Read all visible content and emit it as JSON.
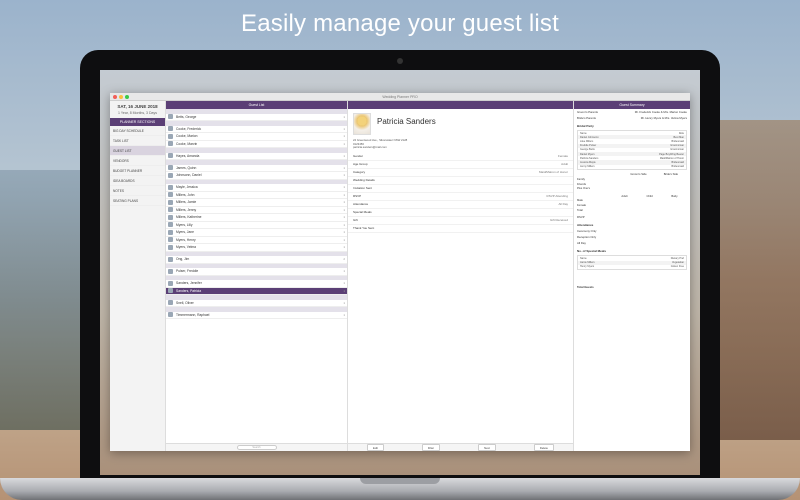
{
  "headline": "Easily manage your guest list",
  "app": {
    "window_title": "Wedding Planner PRO",
    "sidebar": {
      "date": "SAT, 16 JUNE 2018",
      "countdown": "1 Year, 8 Months, 3 Days",
      "section_header": "PLANNER SECTIONS",
      "items": [
        {
          "label": "BIG DAY SCHEDULE"
        },
        {
          "label": "TASK LIST"
        },
        {
          "label": "GUEST LIST"
        },
        {
          "label": "VENDORS"
        },
        {
          "label": "BUDGET PLANNER"
        },
        {
          "label": "IDEA BOARDS"
        },
        {
          "label": "NOTES"
        },
        {
          "label": "SEATING PLANS"
        }
      ]
    },
    "guest_list": {
      "header": "Guest List",
      "rows": [
        {
          "type": "divider"
        },
        {
          "type": "guest",
          "name": "Betts, George",
          "count": "1"
        },
        {
          "type": "divider"
        },
        {
          "type": "guest",
          "name": "Cooke, Frederick",
          "count": "1"
        },
        {
          "type": "guest",
          "name": "Cooke, Marion",
          "count": "1"
        },
        {
          "type": "guest",
          "name": "Cooke, Marvin",
          "count": "1"
        },
        {
          "type": "divider"
        },
        {
          "type": "guest",
          "name": "Hayes, Amanda",
          "count": "1"
        },
        {
          "type": "divider"
        },
        {
          "type": "guest",
          "name": "James, Quinn",
          "count": "1"
        },
        {
          "type": "guest",
          "name": "Johnsonn, Daniel",
          "count": "1"
        },
        {
          "type": "divider"
        },
        {
          "type": "guest",
          "name": "Mayle, Jessica",
          "count": "1"
        },
        {
          "type": "guest",
          "name": "Millers, John",
          "count": "1"
        },
        {
          "type": "guest",
          "name": "Millers, Jamie",
          "count": "1"
        },
        {
          "type": "guest",
          "name": "Millers, Jenny",
          "count": "1"
        },
        {
          "type": "guest",
          "name": "Millers, Katherine",
          "count": "1"
        },
        {
          "type": "guest",
          "name": "Myers, Lilly",
          "count": "1"
        },
        {
          "type": "guest",
          "name": "Myers, Jane",
          "count": "1"
        },
        {
          "type": "guest",
          "name": "Myers, Henry",
          "count": "1"
        },
        {
          "type": "guest",
          "name": "Myers, Velma",
          "count": "1"
        },
        {
          "type": "divider"
        },
        {
          "type": "guest",
          "name": "Ong, Jim",
          "count": "2"
        },
        {
          "type": "divider"
        },
        {
          "type": "guest",
          "name": "Pulser, Freddie",
          "count": "1"
        },
        {
          "type": "divider"
        },
        {
          "type": "guest",
          "name": "Sanders, Jennifer",
          "count": "1"
        },
        {
          "type": "selected",
          "name": "Sanders, Patricia",
          "count": "1"
        },
        {
          "type": "divider"
        },
        {
          "type": "guest",
          "name": "Snell, Oliver",
          "count": "1"
        },
        {
          "type": "divider"
        },
        {
          "type": "guest",
          "name": "Timmermann, Raphael",
          "count": "1"
        }
      ],
      "search_placeholder": "Search"
    },
    "detail": {
      "name": "Patricia Sanders",
      "address_lines": [
        "24 Greenwood Ave., Silverwater NSW 2128",
        "0123456",
        "patricia.sanders@mail.com"
      ],
      "fields": [
        {
          "k": "Gender",
          "v": "Female"
        },
        {
          "k": "Age Group",
          "v": "Adult"
        },
        {
          "k": "Category",
          "v": "Maid/Matron of Honor"
        },
        {
          "k": "Wedding Details",
          "v": ""
        },
        {
          "k": "Invitation Sent",
          "v": ""
        },
        {
          "k": "RSVP",
          "v": "RSVP Attending"
        },
        {
          "k": "Attendance",
          "v": "All Day"
        },
        {
          "k": "Special Meals",
          "v": ""
        },
        {
          "k": "Gift",
          "v": "Gift Received"
        },
        {
          "k": "Thank You Sent",
          "v": ""
        }
      ],
      "buttons": [
        "Edit",
        "Filter",
        "Next",
        "Delete"
      ]
    },
    "summary": {
      "header": "Guest Summary",
      "parents": [
        {
          "k": "Groom's Parents",
          "v": "Mr. Frederick Cooke & Mrs. Marion Cooke"
        },
        {
          "k": "Bride's Parents",
          "v": "Mr. Henry Myers & Mrs. Velma Myers"
        }
      ],
      "bridal_party_title": "Bridal Party",
      "bridal_party": [
        {
          "name": "Name",
          "role": "Role"
        },
        {
          "name": "Daniel Johnsonn",
          "role": "Best Man"
        },
        {
          "name": "Lilee Millers",
          "role": "Bridesmaid"
        },
        {
          "name": "Freddie Pulser",
          "role": "Groomsman"
        },
        {
          "name": "George Betts",
          "role": "Groomsman"
        },
        {
          "name": "Daniel Myers",
          "role": "Page Boy/Ring Bearer"
        },
        {
          "name": "Patricia Sanders",
          "role": "Maid/Matron of Honor"
        },
        {
          "name": "Jessica Mayle",
          "role": "Bridesmaid"
        },
        {
          "name": "Jenny Millers",
          "role": "Bridesmaid"
        }
      ],
      "side_header": [
        "",
        "Groom's Side",
        "Bride's Side"
      ],
      "sides": [
        {
          "k": "Family",
          "a": "",
          "b": ""
        },
        {
          "k": "Friends",
          "a": "",
          "b": ""
        },
        {
          "k": "Plus One's",
          "a": "",
          "b": ""
        }
      ],
      "age_header": [
        "",
        "Adult",
        "Child",
        "Baby"
      ],
      "ages": [
        {
          "k": "Male",
          "a": "",
          "b": "",
          "c": ""
        },
        {
          "k": "Female",
          "a": "",
          "b": "",
          "c": ""
        },
        {
          "k": "Total",
          "a": "",
          "b": "",
          "c": ""
        }
      ],
      "rsvp_label": "RSVP",
      "attendance_title": "Attendance",
      "attendance": [
        {
          "k": "Ceremony Only",
          "v": ""
        },
        {
          "k": "Reception Only",
          "v": ""
        },
        {
          "k": "All Day",
          "v": ""
        }
      ],
      "meals_title": "No. of Special Meals",
      "meals": [
        {
          "name": "Name",
          "meal": "Dietary Pref"
        },
        {
          "name": "Jamie Millers",
          "meal": "Vegetarian"
        },
        {
          "name": "Henry Myers",
          "meal": "Gluten Free"
        }
      ],
      "total_guests_label": "Total Guests",
      "total_guests_value": ""
    }
  }
}
